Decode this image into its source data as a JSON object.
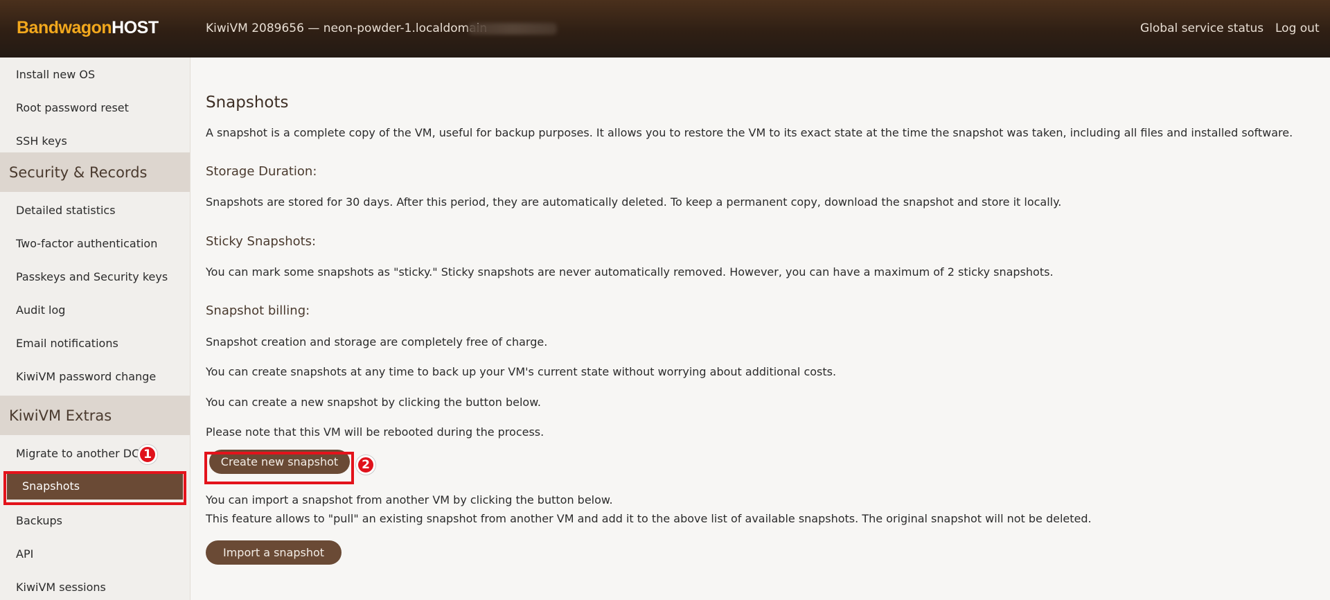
{
  "header": {
    "brand_part1": "Bandwagon",
    "brand_part2": "HOST",
    "vm_title": "KiwiVM 2089656 — neon-powder-1.localdomain",
    "links": [
      "Global service status",
      "Log out"
    ]
  },
  "sidebar": {
    "items_top": [
      "Install new OS",
      "Root password reset",
      "SSH keys"
    ],
    "section_security": "Security & Records",
    "items_security": [
      "Detailed statistics",
      "Two-factor authentication",
      "Passkeys and Security keys",
      "Audit log",
      "Email notifications",
      "KiwiVM password change"
    ],
    "section_extras": "KiwiVM Extras",
    "items_extras": [
      "Migrate to another DC",
      "Snapshots",
      "Backups",
      "API",
      "KiwiVM sessions"
    ],
    "active_item": "Snapshots"
  },
  "annotations": {
    "badge1": "1",
    "badge2": "2"
  },
  "main": {
    "title": "Snapshots",
    "intro": "A snapshot is a complete copy of the VM, useful for backup purposes. It allows you to restore the VM to its exact state at the time the snapshot was taken, including all files and installed software.",
    "storage_heading": "Storage Duration:",
    "storage_text": "Snapshots are stored for 30 days. After this period, they are automatically deleted. To keep a permanent copy, download the snapshot and store it locally.",
    "sticky_heading": "Sticky Snapshots:",
    "sticky_text": "You can mark some snapshots as \"sticky.\" Sticky snapshots are never automatically removed. However, you can have a maximum of 2 sticky snapshots.",
    "billing_heading": "Snapshot billing:",
    "billing_text1": "Snapshot creation and storage are completely free of charge.",
    "billing_text2": "You can create snapshots at any time to back up your VM's current state without worrying about additional costs.",
    "create_hint": "You can create a new snapshot by clicking the button below.",
    "reboot_note": "Please note that this VM will be rebooted during the process.",
    "create_button": "Create new snapshot",
    "import_hint1": "You can import a snapshot from another VM by clicking the button below.",
    "import_hint2": "This feature allows to \"pull\" an existing snapshot from another VM and add it to the above list of available snapshots. The original snapshot will not be deleted.",
    "import_button": "Import a snapshot"
  },
  "colors": {
    "brand_accent": "#f2a81d",
    "button_brown": "#6a4a35",
    "highlight_red": "#e3131b"
  }
}
